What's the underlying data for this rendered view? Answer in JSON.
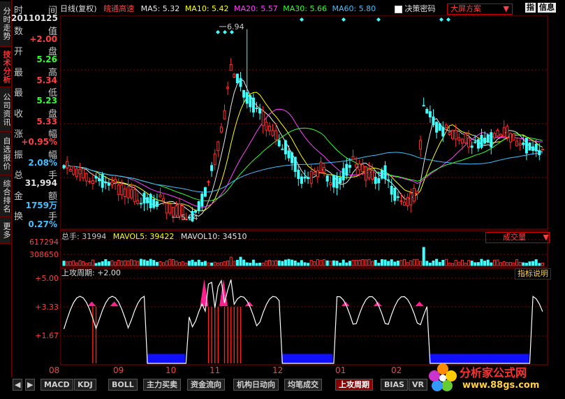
{
  "left_tabs": [
    "分时走势",
    "技术分析",
    "公司资讯",
    "自选报价",
    "综合排名",
    "更多"
  ],
  "info": {
    "rows": [
      {
        "k1": "时",
        "k2": "间",
        "value": "20110125",
        "color": "#e0e0e0"
      },
      {
        "k1": "数",
        "k2": "值",
        "value": "+2.00",
        "color": "#ff4040"
      },
      {
        "k1": "开",
        "k2": "盘",
        "value": "5.26",
        "color": "#30ff30"
      },
      {
        "k1": "最",
        "k2": "高",
        "value": "5.34",
        "color": "#ff4040"
      },
      {
        "k1": "最",
        "k2": "低",
        "value": "5.23",
        "color": "#30ff30"
      },
      {
        "k1": "收",
        "k2": "盘",
        "value": "5.33",
        "color": "#ff4040"
      },
      {
        "k1": "涨",
        "k2": "幅",
        "value": "+0.95%",
        "color": "#ff4040"
      },
      {
        "k1": "振",
        "k2": "幅",
        "value": "2.08%",
        "color": "#40c0ff"
      },
      {
        "k1": "总",
        "k2": "手",
        "value": "31,994",
        "color": "#e0e0e0"
      },
      {
        "k1": "金",
        "k2": "额",
        "value": "1759万",
        "color": "#40c0ff"
      },
      {
        "k1": "换",
        "k2": "手",
        "value": "0.27%",
        "color": "#40c0ff"
      }
    ]
  },
  "header": {
    "period": "日线(复权)",
    "stock_name": "皖通高速",
    "ma5": "MA5: 5.32",
    "ma10": "MA10: 5.42",
    "ma20": "MA20: 5.57",
    "ma30": "MA30: 5.66",
    "ma60": "MA60: 5.80",
    "checkbox_label": "决策密码",
    "scheme": "大屏方案",
    "btn_indicator": "指",
    "btn_info": "信息"
  },
  "colors": {
    "ma5": "#e8e8e8",
    "ma10": "#ffff00",
    "ma20": "#ff40ff",
    "ma30": "#30ff30",
    "ma60": "#40c0ff",
    "up": "#ff3030",
    "down": "#40ffff"
  },
  "annotations": {
    "high": "6.94",
    "low": "5.04"
  },
  "volume": {
    "label_total": "总手: 31994",
    "label_mavol5": "MAVOL5: 39422",
    "label_mavol10": "MAVOL10: 34510",
    "axis": [
      "617294",
      "308650"
    ],
    "selector": "成交量"
  },
  "indicator": {
    "title": "上攻周期: +2.00",
    "help": "指标说明",
    "axis": [
      "+5.00",
      "+3.33",
      "+1.67"
    ]
  },
  "x_axis": [
    "08",
    "09",
    "10",
    "11",
    "12",
    "01",
    "02"
  ],
  "bottom_tabs": [
    "MACD",
    "KDJ",
    "BOLL",
    "主力买卖",
    "资金流向",
    "机构日动向",
    "均笔成交",
    "上攻周期",
    "BIAS",
    "VR"
  ],
  "active_bottom_tab": "上攻周期",
  "watermark": {
    "title": "分析家公式网",
    "url": "www.88gs.com"
  }
}
